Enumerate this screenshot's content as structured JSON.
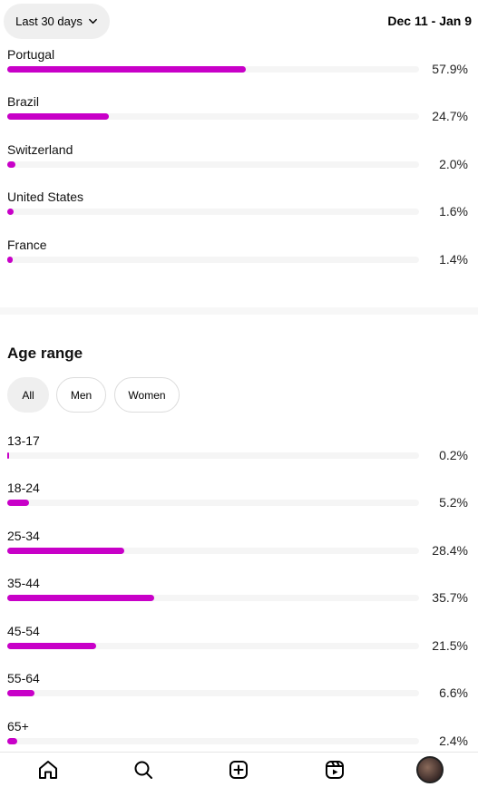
{
  "header": {
    "range_label": "Last 30 days",
    "date_range": "Dec 11 - Jan 9"
  },
  "locations": [
    {
      "label": "Portugal",
      "percent_text": "57.9%",
      "value": 57.9
    },
    {
      "label": "Brazil",
      "percent_text": "24.7%",
      "value": 24.7
    },
    {
      "label": "Switzerland",
      "percent_text": "2.0%",
      "value": 2.0
    },
    {
      "label": "United States",
      "percent_text": "1.6%",
      "value": 1.6
    },
    {
      "label": "France",
      "percent_text": "1.4%",
      "value": 1.4
    }
  ],
  "age_range": {
    "title": "Age range",
    "filters": [
      "All",
      "Men",
      "Women"
    ],
    "selected_filter": "All",
    "items": [
      {
        "label": "13-17",
        "percent_text": "0.2%",
        "value": 0.2
      },
      {
        "label": "18-24",
        "percent_text": "5.2%",
        "value": 5.2
      },
      {
        "label": "25-34",
        "percent_text": "28.4%",
        "value": 28.4
      },
      {
        "label": "35-44",
        "percent_text": "35.7%",
        "value": 35.7
      },
      {
        "label": "45-54",
        "percent_text": "21.5%",
        "value": 21.5
      },
      {
        "label": "55-64",
        "percent_text": "6.6%",
        "value": 6.6
      },
      {
        "label": "65+",
        "percent_text": "2.4%",
        "value": 2.4
      }
    ]
  },
  "colors": {
    "bar_fill": "#c800c8",
    "bar_track": "#f5f5f5"
  },
  "nav": {
    "items": [
      "home-icon",
      "search-icon",
      "create-icon",
      "reels-icon",
      "profile-avatar"
    ]
  }
}
